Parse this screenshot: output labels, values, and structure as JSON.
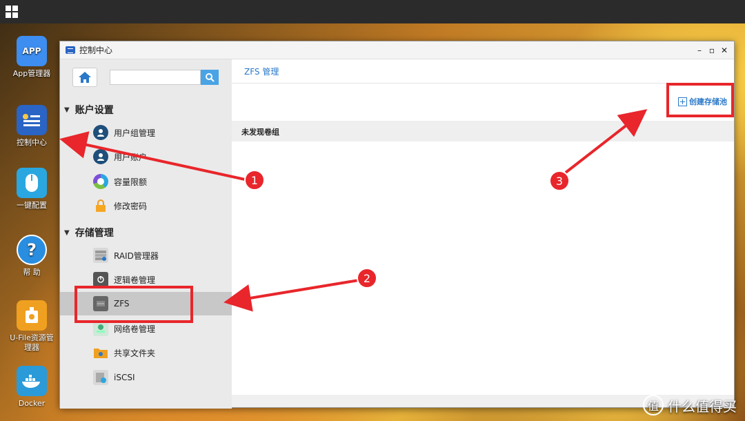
{
  "desktop": {
    "icons": [
      {
        "label": "App管理器",
        "glyph": "APP",
        "color": "#3d8ef0"
      },
      {
        "label": "控制中心",
        "glyph": "",
        "color": "#2a64c4"
      },
      {
        "label": "一键配置",
        "glyph": "",
        "color": "#2aa7e0"
      },
      {
        "label": "帮 助",
        "glyph": "?",
        "color": "#2a8ee0"
      },
      {
        "label": "U-File资源管理器",
        "glyph": "",
        "color": "#f0a020"
      },
      {
        "label": "Docker",
        "glyph": "",
        "color": "#2a9ad8"
      }
    ]
  },
  "window": {
    "title": "控制中心",
    "controls": {
      "minimize": "–",
      "maximize": "▫",
      "close": "✕"
    },
    "search": {
      "placeholder": "",
      "value": ""
    },
    "sidebar": {
      "sections": [
        {
          "label": "账户设置",
          "items": [
            {
              "label": "用户组管理",
              "icon": "user-group-icon"
            },
            {
              "label": "用户账户",
              "icon": "user-account-icon"
            },
            {
              "label": "容量限额",
              "icon": "quota-icon"
            },
            {
              "label": "修改密码",
              "icon": "lock-icon"
            }
          ]
        },
        {
          "label": "存储管理",
          "items": [
            {
              "label": "RAID管理器",
              "icon": "raid-icon"
            },
            {
              "label": "逻辑卷管理",
              "icon": "logical-volume-icon"
            },
            {
              "label": "ZFS",
              "icon": "zfs-icon",
              "active": true
            },
            {
              "label": "网络卷管理",
              "icon": "network-volume-icon"
            },
            {
              "label": "共享文件夹",
              "icon": "shared-folder-icon"
            },
            {
              "label": "iSCSI",
              "icon": "iscsi-icon"
            }
          ]
        }
      ]
    },
    "main": {
      "title": "ZFS 管理",
      "create_button": "创建存储池",
      "empty_message": "未发现卷组"
    }
  },
  "annotations": {
    "badges": [
      "1",
      "2",
      "3"
    ],
    "color": "#e8262b"
  },
  "watermark": {
    "logo": "值",
    "text": "什么值得买"
  }
}
